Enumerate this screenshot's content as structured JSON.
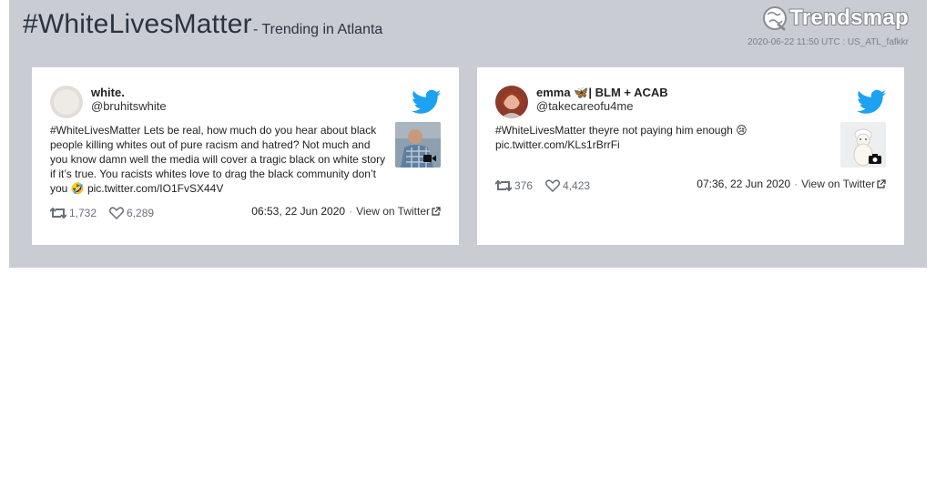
{
  "header": {
    "hashtag": "#WhiteLivesMatter",
    "subtitle": "- Trending in Atlanta",
    "brand": "Trendsmap",
    "meta": "2020-06-22 11:50 UTC : US_ATL_fafkkr"
  },
  "colors": {
    "panel": "#c9ccd3",
    "twitter_blue": "#1da1f2",
    "title": "#2b3340"
  },
  "tweets": [
    {
      "name": "white.",
      "handle": "@bruhitswhite",
      "text": "#WhiteLivesMatter Lets be real, how much do you hear about black people killing whites out of pure racism and hatred? Not much and you know damn well the media will cover a tragic black on white story if it’s true. You racists whites love to drag the black community don’t you 🤣 pic.twitter.com/IO1FvSX44V",
      "retweets": "1,732",
      "likes": "6,289",
      "time": "06:53, 22 Jun 2020",
      "view_label": "View on Twitter",
      "media_icon": "video-camera-icon"
    },
    {
      "name": "emma 🦋| BLM + ACAB",
      "handle": "@takecareofu4me",
      "text": "#WhiteLivesMatter theyre not paying him enough 😢 pic.twitter.com/KLs1rBrrFi",
      "retweets": "376",
      "likes": "4,423",
      "time": "07:36, 22 Jun 2020",
      "view_label": "View on Twitter",
      "media_icon": "camera-icon"
    }
  ]
}
